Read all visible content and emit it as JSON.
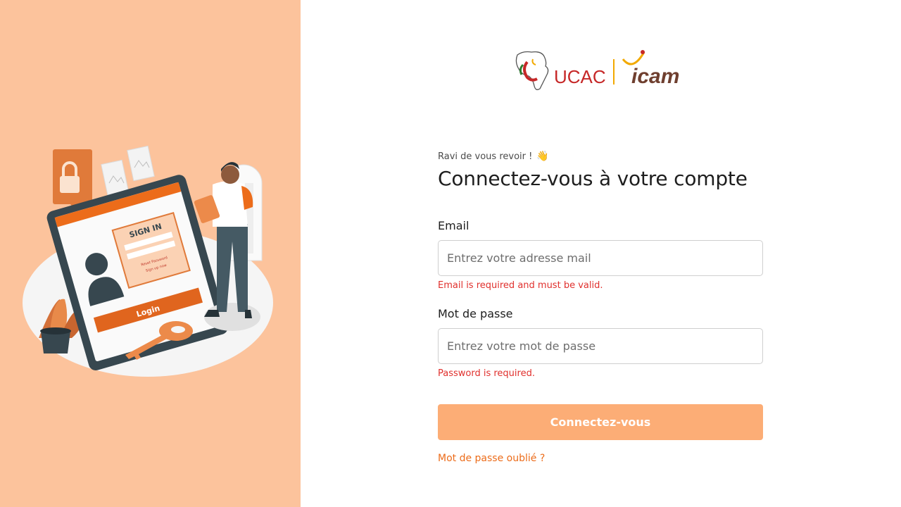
{
  "brand": {
    "logo_icon": "africa-map-logo-icon",
    "ucac_text": "UCAC",
    "icam_text": "icam",
    "colors": {
      "ucac_red": "#c62828",
      "icam_brown": "#6f3f2f",
      "icam_accent": "#f2a900",
      "green": "#2e7d32"
    }
  },
  "illustration": {
    "screen_title": "SIGN IN",
    "screen_reset": "Reset Password",
    "screen_signup": "Sign up now",
    "login_bar": "Login"
  },
  "form": {
    "greeting": "Ravi de vous revoir !",
    "greeting_icon": "waving-hand-icon",
    "title": "Connectez-vous à votre compte",
    "email_label": "Email",
    "email_placeholder": "Entrez votre adresse mail",
    "email_error": "Email is required and must be valid.",
    "password_label": "Mot de passe",
    "password_placeholder": "Entrez votre mot de passe",
    "password_error": "Password is required.",
    "submit_label": "Connectez-vous",
    "forgot_label": "Mot de passe oublié ?"
  },
  "colors": {
    "left_panel_bg": "#fcc39c",
    "primary_orange": "#ec6c1a",
    "button_bg": "#fcad76",
    "error": "#e0302d"
  }
}
